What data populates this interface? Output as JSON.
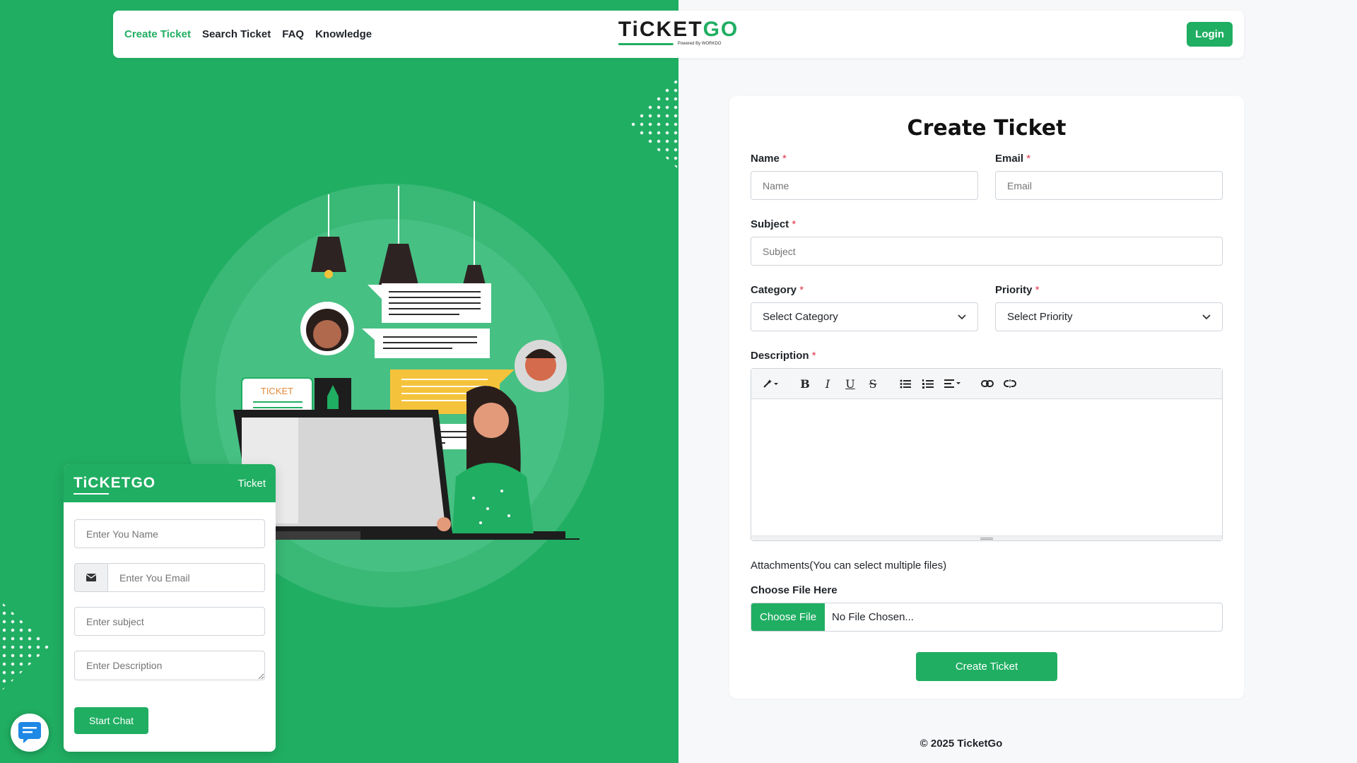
{
  "nav": {
    "links": [
      "Create Ticket",
      "Search Ticket",
      "FAQ",
      "Knowledge"
    ],
    "brand": {
      "part1": "TiCKET",
      "part2": "GO",
      "tagline": "Powered By WORKDO"
    },
    "login": "Login"
  },
  "illustration": {
    "ticket_label": "TICKET"
  },
  "chat_widget": {
    "logo": "TiCKETGO",
    "title": "Ticket",
    "name_placeholder": "Enter You Name",
    "email_placeholder": "Enter You Email",
    "subject_placeholder": "Enter subject",
    "description_placeholder": "Enter Description",
    "start_button": "Start Chat"
  },
  "form": {
    "title": "Create Ticket",
    "name_label": "Name",
    "name_placeholder": "Name",
    "email_label": "Email",
    "email_placeholder": "Email",
    "subject_label": "Subject",
    "subject_placeholder": "Subject",
    "category_label": "Category",
    "category_value": "Select Category",
    "priority_label": "Priority",
    "priority_value": "Select Priority",
    "description_label": "Description",
    "attachments_label": "Attachments(You can select multiple files)",
    "choose_file_label": "Choose File Here",
    "choose_file_button": "Choose File",
    "no_file_text": "No File Chosen...",
    "submit": "Create Ticket",
    "required_mark": "*"
  },
  "footer": {
    "copyright": "© 2025 TicketGo"
  },
  "colors": {
    "brand": "#20ae62",
    "required": "#e0364b"
  }
}
